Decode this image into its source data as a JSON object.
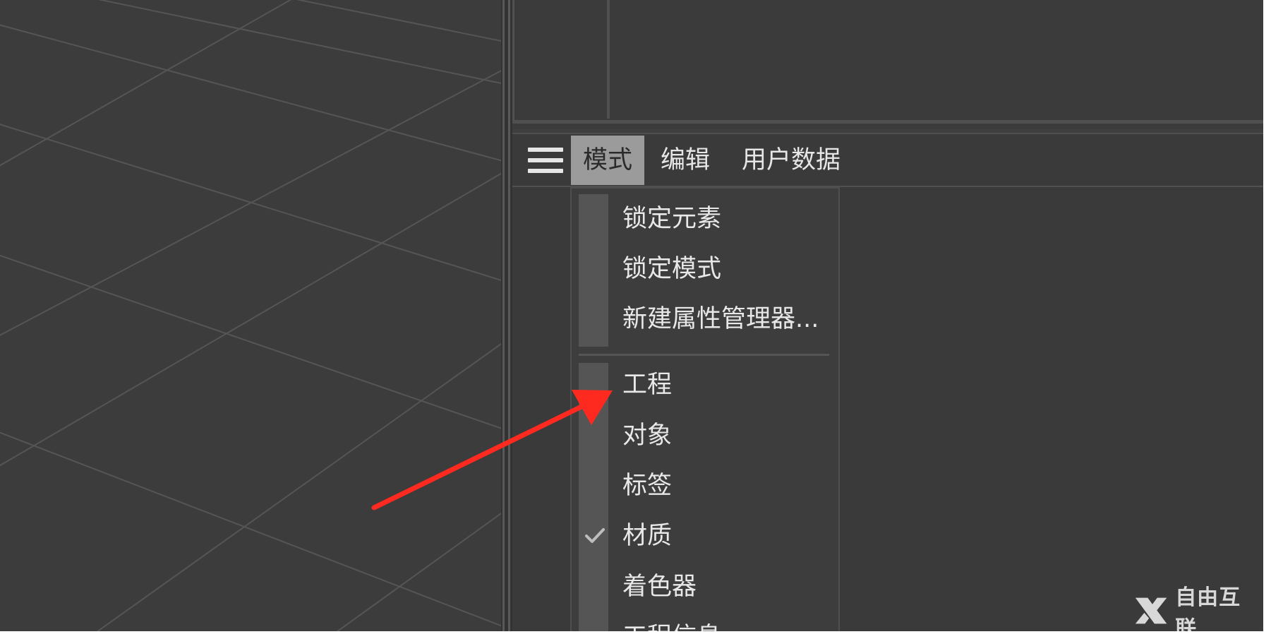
{
  "menubar": {
    "hamburger_icon": "hamburger-menu-icon",
    "items": [
      {
        "label": "模式",
        "active": true
      },
      {
        "label": "编辑",
        "active": false
      },
      {
        "label": "用户数据",
        "active": false
      }
    ]
  },
  "dropdown": {
    "group1": [
      {
        "label": "锁定元素"
      },
      {
        "label": "锁定模式"
      },
      {
        "label": "新建属性管理器..."
      }
    ],
    "group2": [
      {
        "label": "工程",
        "checked": false
      },
      {
        "label": "对象",
        "checked": false
      },
      {
        "label": "标签",
        "checked": false
      },
      {
        "label": "材质",
        "checked": true
      },
      {
        "label": "着色器",
        "checked": false
      },
      {
        "label": "工程信息",
        "checked": false
      }
    ]
  },
  "annotation": {
    "arrow_color": "#ff2a1f",
    "points_to": "工程"
  },
  "watermark": {
    "text": "自由互联",
    "icon": "x-logo-icon"
  },
  "colors": {
    "background": "#3f3f3f",
    "menu_active_bg": "#9b9b9b",
    "text": "#e6e6e6",
    "gutter": "#555555"
  }
}
